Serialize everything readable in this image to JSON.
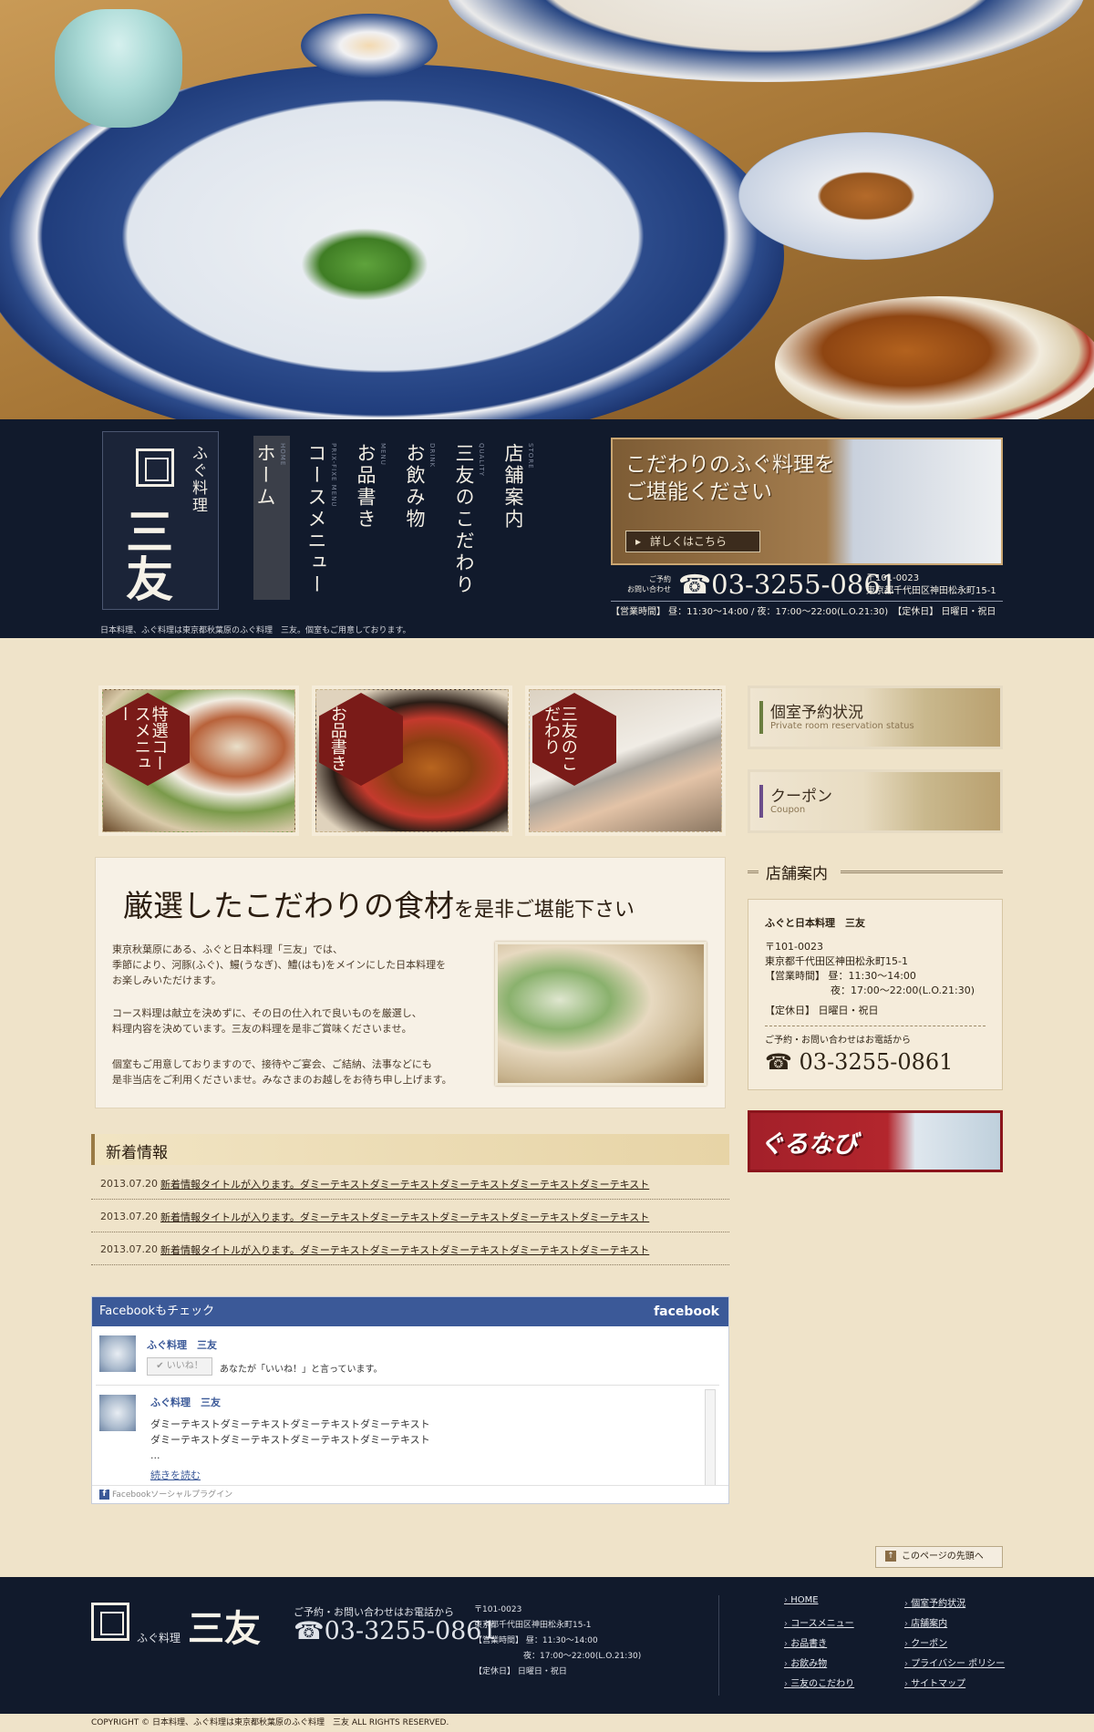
{
  "colors": {
    "navy": "#111a2c",
    "accent": "#7a1b18",
    "bg": "#efe3c9",
    "facebook": "#3b5998"
  },
  "site": {
    "logo_sub": "ふぐ料理",
    "logo_name": "三友",
    "tagline": "日本料理、ふぐ料理は東京都秋葉原のふぐ料理　三友。個室もご用意しております。"
  },
  "nav": [
    {
      "jp": "ホーム",
      "en": "HOME",
      "icon": "home"
    },
    {
      "jp": "コースメニュー",
      "en": "PRIX-FIXE MENU",
      "icon": "course"
    },
    {
      "jp": "お品書き",
      "en": "MENU",
      "icon": "menu"
    },
    {
      "jp": "お飲み物",
      "en": "DRINK",
      "icon": "drink"
    },
    {
      "jp": "三友のこだわり",
      "en": "QUALITY",
      "icon": "quality"
    },
    {
      "jp": "店舗案内",
      "en": "STORE",
      "icon": "store"
    }
  ],
  "hero_banner": {
    "line1": "こだわりのふぐ料理を",
    "line2": "ご堪能ください",
    "button": "詳しくはこちら"
  },
  "contact": {
    "label1": "ご予約",
    "label2": "お問い合わせ",
    "phone": "03-3255-0861",
    "zip": "〒101-0023",
    "address": "東京都千代田区神田松永町15-1",
    "hours": "【営業時間】 昼：11:30～14:00 / 夜：17:00～22:00(L.O.21:30)　【定休日】 日曜日・祝日"
  },
  "tiles": [
    {
      "label": "特選コースメニュー"
    },
    {
      "label": "お品書き"
    },
    {
      "label": "三友のこだわり"
    }
  ],
  "side_buttons": [
    {
      "title": "個室予約状況",
      "sub": "Private room reservation status"
    },
    {
      "title": "クーポン",
      "sub": "Coupon"
    }
  ],
  "intro": {
    "heading_big": "厳選したこだわりの食材",
    "heading_small": "を是非ご堪能下さい",
    "p1a": "東京秋葉原にある、ふぐと日本料理「三友」では、",
    "p1b": "季節により、河豚(ふぐ)、鰻(うなぎ)、鱧(はも)をメインにした日本料理を",
    "p1c": "お楽しみいただけます。",
    "p2a": "コース料理は献立を決めずに、その日の仕入れで良いものを厳選し、",
    "p2b": "料理内容を決めています。三友の料理を是非ご賞味くださいませ。",
    "p3a": "個室もご用意しておりますので、接待やご宴会、ご結納、法事などにも",
    "p3b": "是非当店をご利用くださいませ。みなさまのお越しをお待ち申し上げます。"
  },
  "shop": {
    "heading": "店舗案内",
    "name": "ふぐと日本料理　三友",
    "zip": "〒101-0023",
    "address": "東京都千代田区神田松永町15-1",
    "hours_label": "【営業時間】",
    "hours_day": "昼：11:30～14:00",
    "hours_night": "夜：17:00～22:00(L.O.21:30)",
    "closed": "【定休日】 日曜日・祝日",
    "tel_label": "ご予約・お問い合わせはお電話から",
    "phone": "☎ 03-3255-0861"
  },
  "gurunavi": {
    "label": "ぐるなび"
  },
  "news": {
    "heading": "新着情報",
    "items": [
      {
        "date": "2013.07.20",
        "title": "新着情報タイトルが入ります。ダミーテキストダミーテキストダミーテキストダミーテキストダミーテキスト"
      },
      {
        "date": "2013.07.20",
        "title": "新着情報タイトルが入ります。ダミーテキストダミーテキストダミーテキストダミーテキストダミーテキスト"
      },
      {
        "date": "2013.07.20",
        "title": "新着情報タイトルが入ります。ダミーテキストダミーテキストダミーテキストダミーテキストダミーテキスト"
      }
    ]
  },
  "facebook": {
    "header": "Facebookもチェック",
    "brand": "facebook",
    "page_name": "ふぐ料理　三友",
    "like_btn": "✔ いいね！",
    "like_text": "あなたが「いいね！」と言っています。",
    "post_name": "ふぐ料理　三友",
    "post_line1": "ダミーテキストダミーテキストダミーテキストダミーテキスト",
    "post_line2": "ダミーテキストダミーテキストダミーテキストダミーテキスト",
    "ellipsis": "...",
    "read_more": "続きを読む",
    "plugin": "Facebookソーシャルプラグイン"
  },
  "gotop": "このページの先頭へ",
  "footer": {
    "logo_sub": "ふぐ料理",
    "logo_name": "三友",
    "tel_label": "ご予約・お問い合わせはお電話から",
    "phone": "☎03-3255-0861",
    "address": "〒101-0023\n東京都千代田区神田松永町15-1\n【営業時間】 昼：11:30～14:00\n　　　　　　夜：17:00～22:00(L.O.21:30)\n【定休日】 日曜日・祝日",
    "links_col1": [
      "HOME",
      "コースメニュー",
      "お品書き",
      "お飲み物",
      "三友のこだわり"
    ],
    "links_col2": [
      "個室予約状況",
      "店舗案内",
      "クーポン",
      "プライバシー ポリシー",
      "サイトマップ"
    ]
  },
  "copyright": "COPYRIGHT © 日本料理、ふぐ料理は東京都秋葉原のふぐ料理　三友 ALL RIGHTS RESERVED."
}
